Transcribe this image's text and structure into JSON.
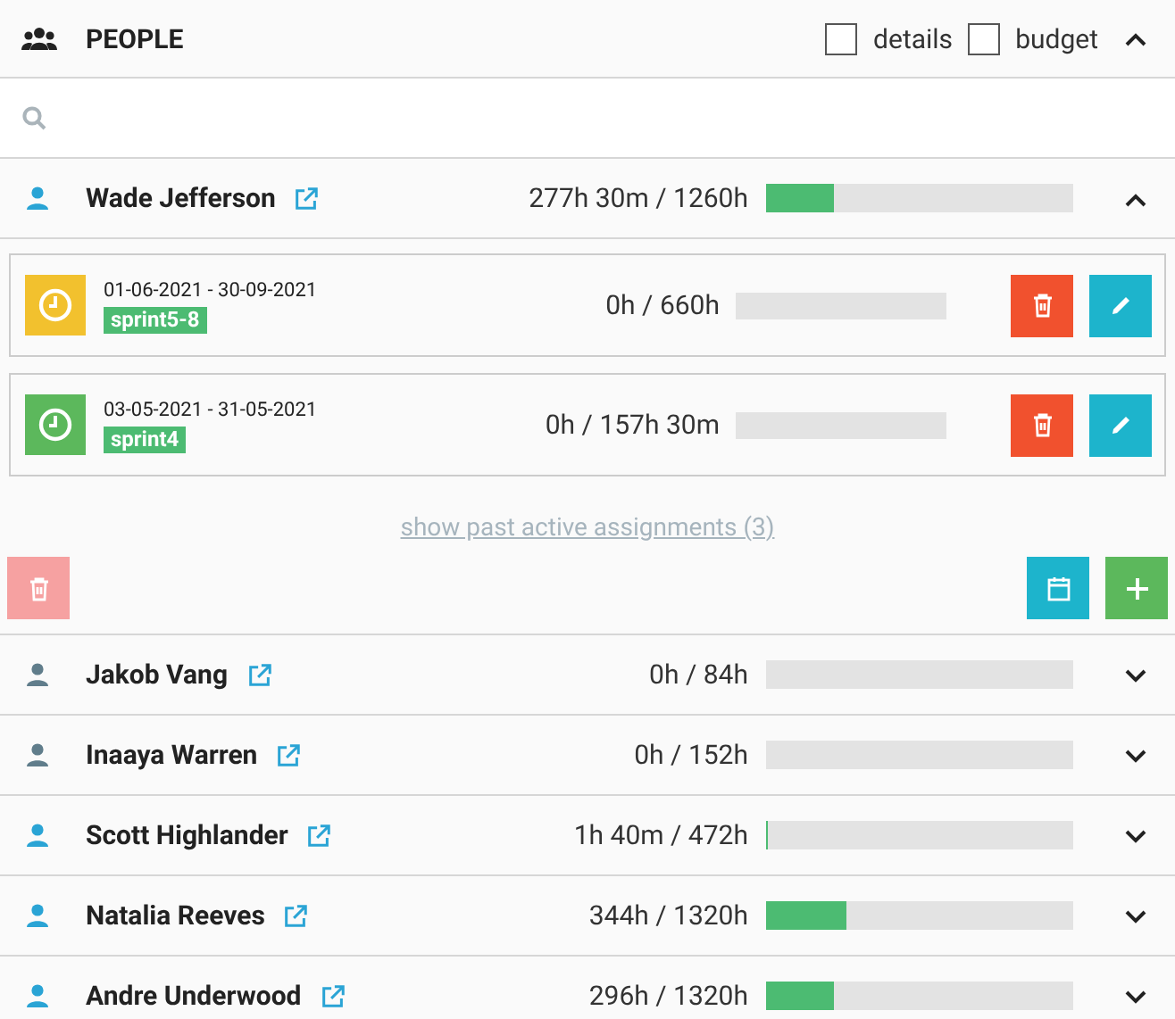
{
  "header": {
    "title": "PEOPLE",
    "options": [
      {
        "label": "details",
        "checked": false
      },
      {
        "label": "budget",
        "checked": false
      }
    ],
    "expanded": true
  },
  "people": [
    {
      "name": "Wade Jefferson",
      "color": "#2aa4d5",
      "hours": "277h 30m / 1260h",
      "level": 0.22,
      "expanded": true,
      "assignments": [
        {
          "color": "#f2c12e",
          "dates": "01-06-2021 - 30-09-2021",
          "tag": "sprint5-8",
          "hours": "0h / 660h",
          "level": 0
        },
        {
          "color": "#5cb85c",
          "dates": "03-05-2021 - 31-05-2021",
          "tag": "sprint4",
          "hours": "0h / 157h 30m",
          "level": 0
        }
      ],
      "past_link": "show past active assignments (3)",
      "delete_disabled": true
    },
    {
      "name": "Jakob Vang",
      "color": "#607d8b",
      "hours": "0h / 84h",
      "expanded": false
    },
    {
      "name": "Inaaya Warren",
      "color": "#607d8b",
      "hours": "0h / 152h",
      "expanded": false
    },
    {
      "name": "Scott Highlander",
      "color": "#2aa4d5",
      "hours": "1h 40m / 472h",
      "level": 0.006,
      "expanded": false
    },
    {
      "name": "Natalia Reeves",
      "color": "#2aa4d5",
      "hours": "344h / 1320h",
      "level": 0.26,
      "expanded": false
    },
    {
      "name": "Andre Underwood",
      "color": "#2aa4d5",
      "hours": "296h / 1320h",
      "level": 0.22,
      "expanded": false
    }
  ]
}
